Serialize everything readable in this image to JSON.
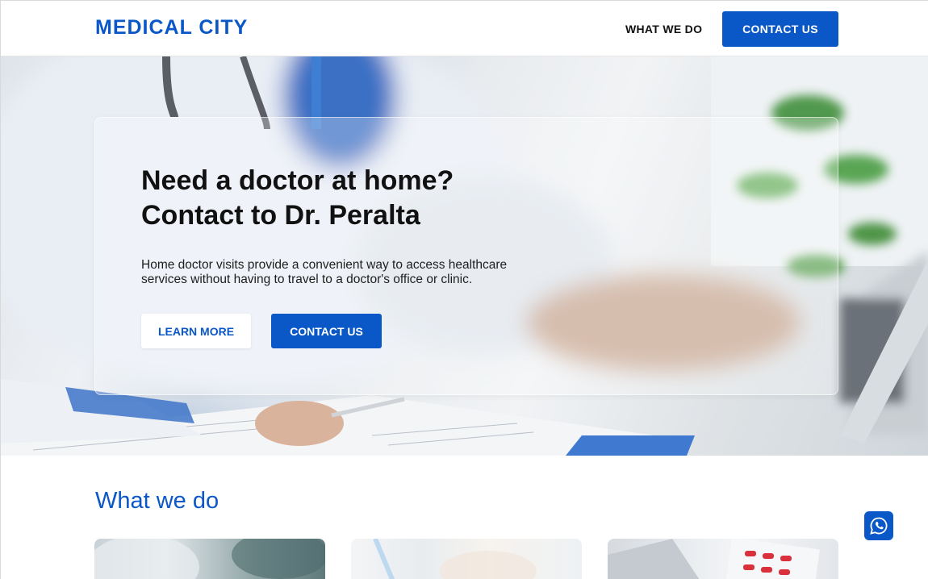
{
  "header": {
    "logo": "MEDICAL CITY",
    "nav": {
      "what_we_do": "WHAT WE DO"
    },
    "cta": "CONTACT US"
  },
  "hero": {
    "title_line1": "Need a doctor at home?",
    "title_line2": "Contact to Dr. Peralta",
    "text_line1": "Home doctor visits provide a convenient way to access healthcare",
    "text_line2": "services without having to travel to a doctor's office or clinic.",
    "learn_more": "LEARN MORE",
    "contact": "CONTACT US"
  },
  "services": {
    "title": "What we do"
  },
  "floating": {
    "icon": "whatsapp-icon"
  },
  "colors": {
    "accent": "#0a57c8",
    "text": "#111111",
    "background": "#ffffff"
  }
}
